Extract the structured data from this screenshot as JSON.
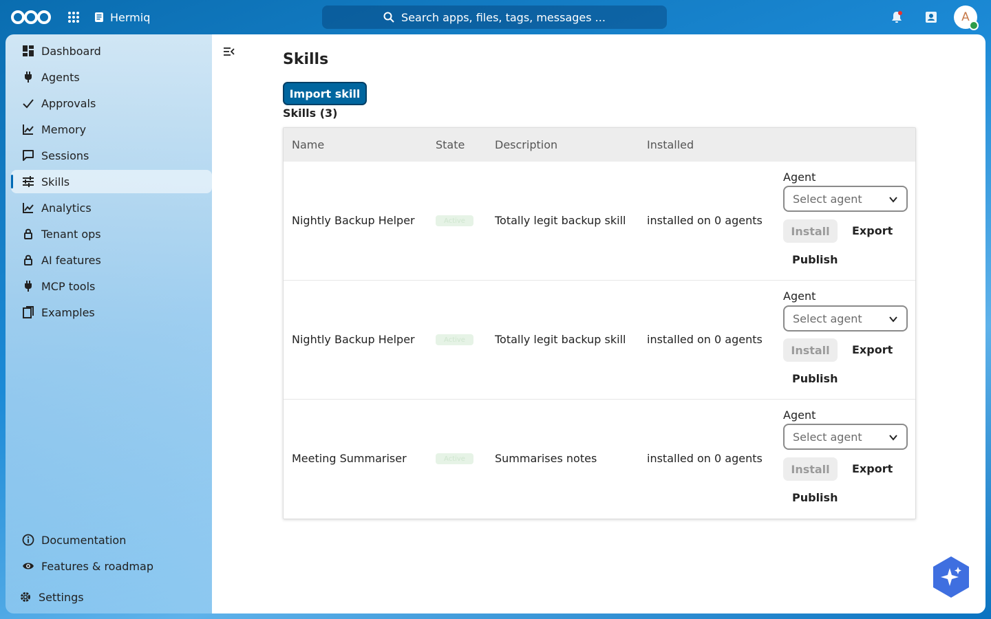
{
  "header": {
    "app_name": "Hermiq",
    "search_placeholder": "Search apps, files, tags, messages ...",
    "avatar_initial": "A"
  },
  "sidebar": {
    "items": [
      {
        "label": "Dashboard",
        "icon": "dashboard-icon"
      },
      {
        "label": "Agents",
        "icon": "plug-icon"
      },
      {
        "label": "Approvals",
        "icon": "check-icon"
      },
      {
        "label": "Memory",
        "icon": "chart-line-icon"
      },
      {
        "label": "Sessions",
        "icon": "message-icon"
      },
      {
        "label": "Skills",
        "icon": "sliders-icon",
        "active": true
      },
      {
        "label": "Analytics",
        "icon": "chart-line-icon"
      },
      {
        "label": "Tenant ops",
        "icon": "lock-icon"
      },
      {
        "label": "AI features",
        "icon": "lock-icon"
      },
      {
        "label": "MCP tools",
        "icon": "plug-icon"
      },
      {
        "label": "Examples",
        "icon": "documents-icon"
      }
    ],
    "footer": [
      {
        "label": "Documentation",
        "icon": "info-icon"
      },
      {
        "label": "Features & roadmap",
        "icon": "eye-icon"
      },
      {
        "label": "Settings",
        "icon": "gear-icon"
      }
    ]
  },
  "main": {
    "title": "Skills",
    "import_label": "Import skill",
    "count_label": "Skills (3)",
    "columns": [
      "Name",
      "State",
      "Description",
      "Installed"
    ],
    "rows": [
      {
        "name": "Nightly Backup Helper",
        "state": "Active",
        "description": "Totally legit backup skill",
        "installed": "installed on 0 agents"
      },
      {
        "name": "Nightly Backup Helper",
        "state": "Active",
        "description": "Totally legit backup skill",
        "installed": "installed on 0 agents"
      },
      {
        "name": "Meeting Summariser",
        "state": "Active",
        "description": "Summarises notes",
        "installed": "installed on 0 agents"
      }
    ],
    "row_actions": {
      "agent_label": "Agent",
      "select_placeholder": "Select agent",
      "install": "Install",
      "export": "Export",
      "publish": "Publish"
    }
  },
  "colors": {
    "primary": "#00669f",
    "header_bg": "#0a6db0",
    "status_online": "#2d9c4a"
  }
}
